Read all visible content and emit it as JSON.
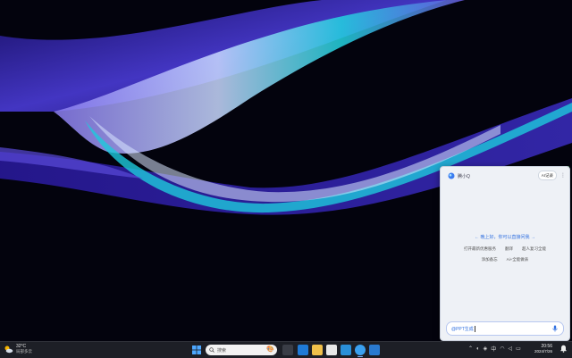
{
  "assistant": {
    "app_name": "腾小Q",
    "history_label": "AI记录",
    "greeting": "← 晚上好，你可以直接问我 →",
    "suggestions_row1": [
      "打开最新优惠服务",
      "翻译",
      "超人复习全能"
    ],
    "suggestions_row2": [
      "添加备忘",
      "Ai+全能做表"
    ],
    "input_value": "@PPT生成",
    "collapse_icon": "chevron-left-icon"
  },
  "taskbar": {
    "weather_temp": "32°C",
    "weather_desc": "局部多云",
    "search_placeholder": "搜索",
    "clock_time": "20:56",
    "clock_date": "2024/7/26"
  },
  "colors": {
    "accent": "#2f6fe0",
    "taskbar_bg": "#1d1f26",
    "panel_bg": "#eef1f6"
  }
}
